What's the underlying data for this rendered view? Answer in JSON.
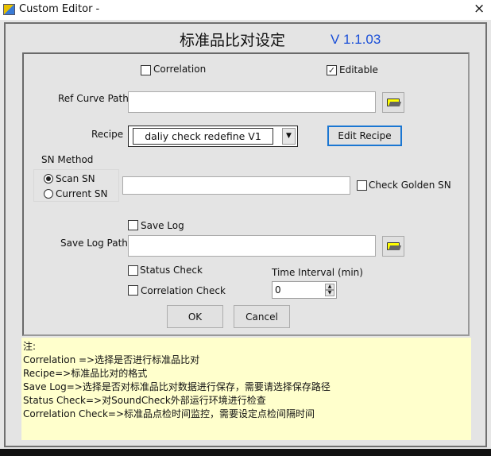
{
  "window": {
    "title": "Custom Editor -",
    "icon": "labview-vi-icon",
    "close": "×"
  },
  "heading": "标准品比对设定",
  "version": "V 1.1.03",
  "colors": {
    "version": "#1a4fd8",
    "notes_bg": "#ffffcc",
    "focus_border": "#1a76d2"
  },
  "correlation": {
    "label": "Correlation",
    "checked": false
  },
  "editable": {
    "label": "Editable",
    "checked": true
  },
  "ref_curve": {
    "label": "Ref Curve Path",
    "value": ""
  },
  "recipe": {
    "label": "Recipe",
    "selected": "daliy check redefine V1",
    "edit_label": "Edit Recipe"
  },
  "sn": {
    "label": "SN Method",
    "options": [
      "Scan SN",
      "Current SN"
    ],
    "selected": "Scan SN",
    "value": "",
    "golden_label": "Check Golden SN",
    "golden_checked": false
  },
  "save_log": {
    "label": "Save Log",
    "checked": false,
    "path_label": "Save Log Path",
    "path": ""
  },
  "status_check": {
    "label": "Status Check",
    "checked": false
  },
  "correlation_check": {
    "label": "Correlation Check",
    "checked": false
  },
  "time_interval": {
    "label": "Time Interval (min)",
    "value": "0"
  },
  "buttons": {
    "ok": "OK",
    "cancel": "Cancel"
  },
  "notes": [
    "注:",
    "Correlation =>选择是否进行标准品比对",
    "Recipe=>标准品比对的格式",
    "Save Log=>选择是否对标准品比对数据进行保存，需要请选择保存路径",
    "Status Check=>对SoundCheck外部运行环境进行检查",
    "Correlation Check=>标准品点检时间监控，需要设定点检间隔时间"
  ]
}
